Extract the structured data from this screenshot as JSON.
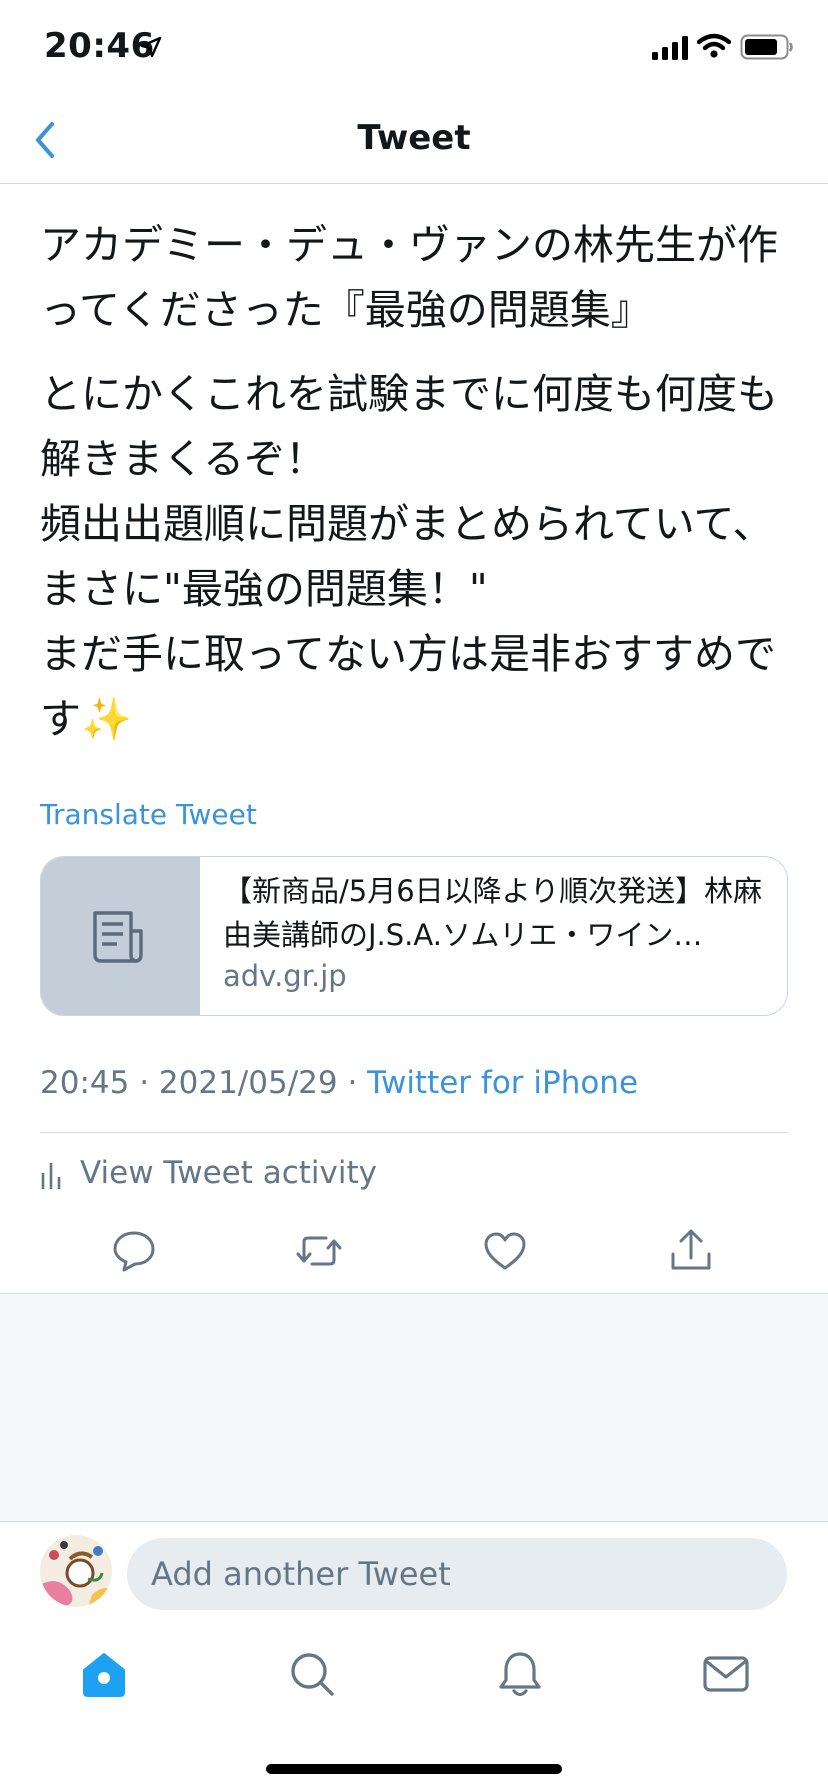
{
  "status_bar": {
    "time": "20:46",
    "icons": [
      "location-arrow-icon",
      "cellular-signal-icon",
      "wifi-icon",
      "battery-icon"
    ]
  },
  "nav": {
    "title": "Tweet",
    "back_icon": "chevron-left-icon"
  },
  "tweet": {
    "paragraphs": [
      "アカデミー・デュ・ヴァンの林先生が作ってくださった『最強の問題集』",
      "とにかくこれを試験までに何度も何度も解きまくるぞ！\n頻出出題順に問題がまとめられていて、まさに\"最強の問題集！\"\nまだ手に取ってない方は是非おすすめです✨"
    ],
    "translate_label": "Translate Tweet",
    "card": {
      "title": "【新商品/5月6日以降より順次発送】林麻由美講師のJ.S.A.ソムリエ・ワイン…",
      "domain": "adv.gr.jp",
      "thumb_icon": "document-icon"
    },
    "time": "20:45",
    "date": "2021/05/29",
    "separator": " · ",
    "source": "Twitter for iPhone",
    "activity_label": "View Tweet activity"
  },
  "actions": [
    "reply-icon",
    "retweet-icon",
    "like-icon",
    "share-icon"
  ],
  "reply_box": {
    "placeholder": "Add another Tweet"
  },
  "tab_bar": [
    "home-icon",
    "search-icon",
    "notifications-icon",
    "messages-icon"
  ],
  "colors": {
    "accent": "#1da1f2",
    "link": "#3b94d9",
    "secondary_text": "#657786",
    "primary_text": "#14171a",
    "background_grey": "#f5f8fa"
  }
}
